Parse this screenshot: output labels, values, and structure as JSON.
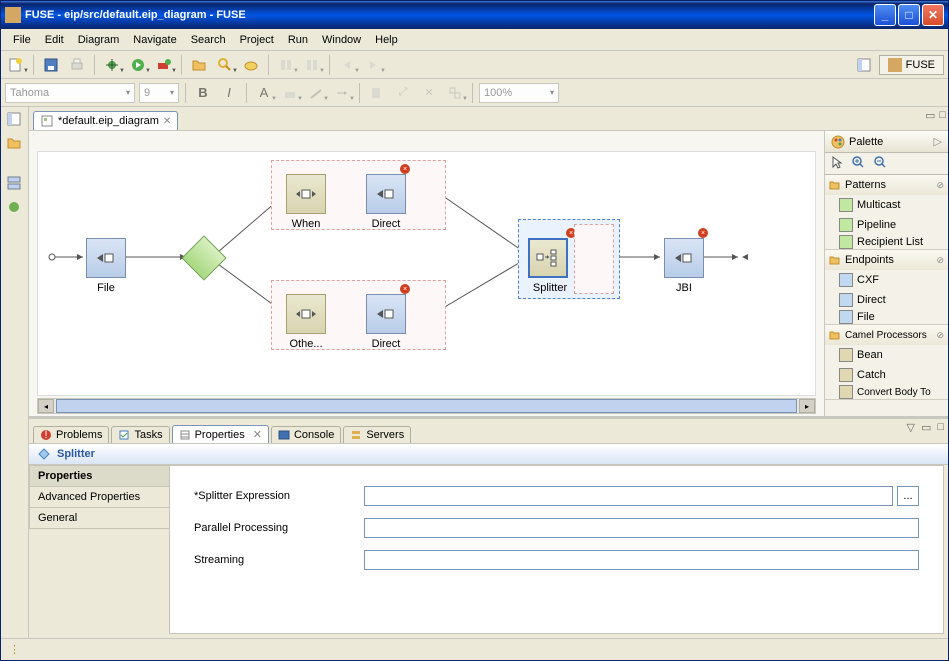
{
  "window": {
    "title": "FUSE - eip/src/default.eip_diagram - FUSE"
  },
  "menu": [
    "File",
    "Edit",
    "Diagram",
    "Navigate",
    "Search",
    "Project",
    "Run",
    "Window",
    "Help"
  ],
  "perspective": {
    "label": "FUSE"
  },
  "toolbar2": {
    "font": "Tahoma",
    "size": "9",
    "zoom": "100%"
  },
  "editor": {
    "tab": "*default.eip_diagram"
  },
  "nodes": {
    "file": "File",
    "when": "When",
    "othe": "Othe...",
    "direct1": "Direct",
    "direct2": "Direct",
    "splitter": "Splitter",
    "jbi": "JBI"
  },
  "palette": {
    "title": "Palette",
    "groups": [
      {
        "name": "Patterns",
        "items": [
          "Multicast",
          "Pipeline",
          "Recipient List"
        ]
      },
      {
        "name": "Endpoints",
        "items": [
          "CXF",
          "Direct",
          "File"
        ]
      },
      {
        "name": "Camel Processors",
        "items": [
          "Bean",
          "Catch",
          "Convert Body To"
        ]
      }
    ]
  },
  "bottomtabs": [
    "Problems",
    "Tasks",
    "Properties",
    "Console",
    "Servers"
  ],
  "props": {
    "heading": "Splitter",
    "sidetabs": [
      "Properties",
      "Advanced Properties",
      "General"
    ],
    "fields": {
      "splitter": "*Splitter Expression",
      "parallel": "Parallel Processing",
      "streaming": "Streaming"
    },
    "values": {
      "splitter_val": "",
      "parallel_val": "",
      "streaming_val": ""
    },
    "browse": "..."
  }
}
